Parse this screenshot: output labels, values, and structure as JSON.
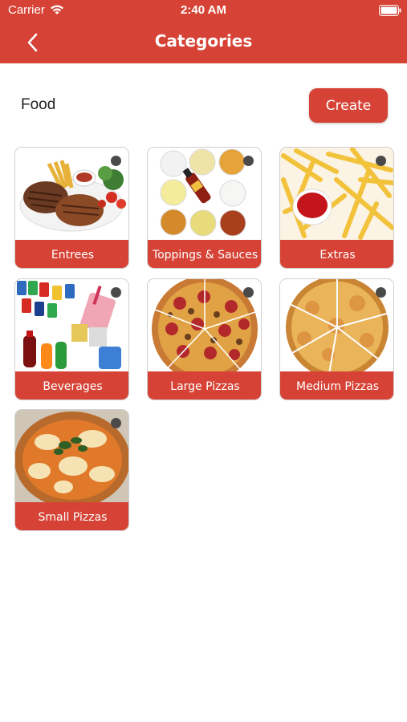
{
  "status_bar": {
    "carrier": "Carrier",
    "time": "2:40 AM"
  },
  "nav": {
    "title": "Categories"
  },
  "section": {
    "label": "Food",
    "create_label": "Create"
  },
  "categories": [
    {
      "label": "Entrees"
    },
    {
      "label": "Toppings & Sauces"
    },
    {
      "label": "Extras"
    },
    {
      "label": "Beverages"
    },
    {
      "label": "Large Pizzas"
    },
    {
      "label": "Medium Pizzas"
    },
    {
      "label": "Small Pizzas"
    }
  ],
  "colors": {
    "accent": "#d64336",
    "dot": "#4a4a4a"
  }
}
